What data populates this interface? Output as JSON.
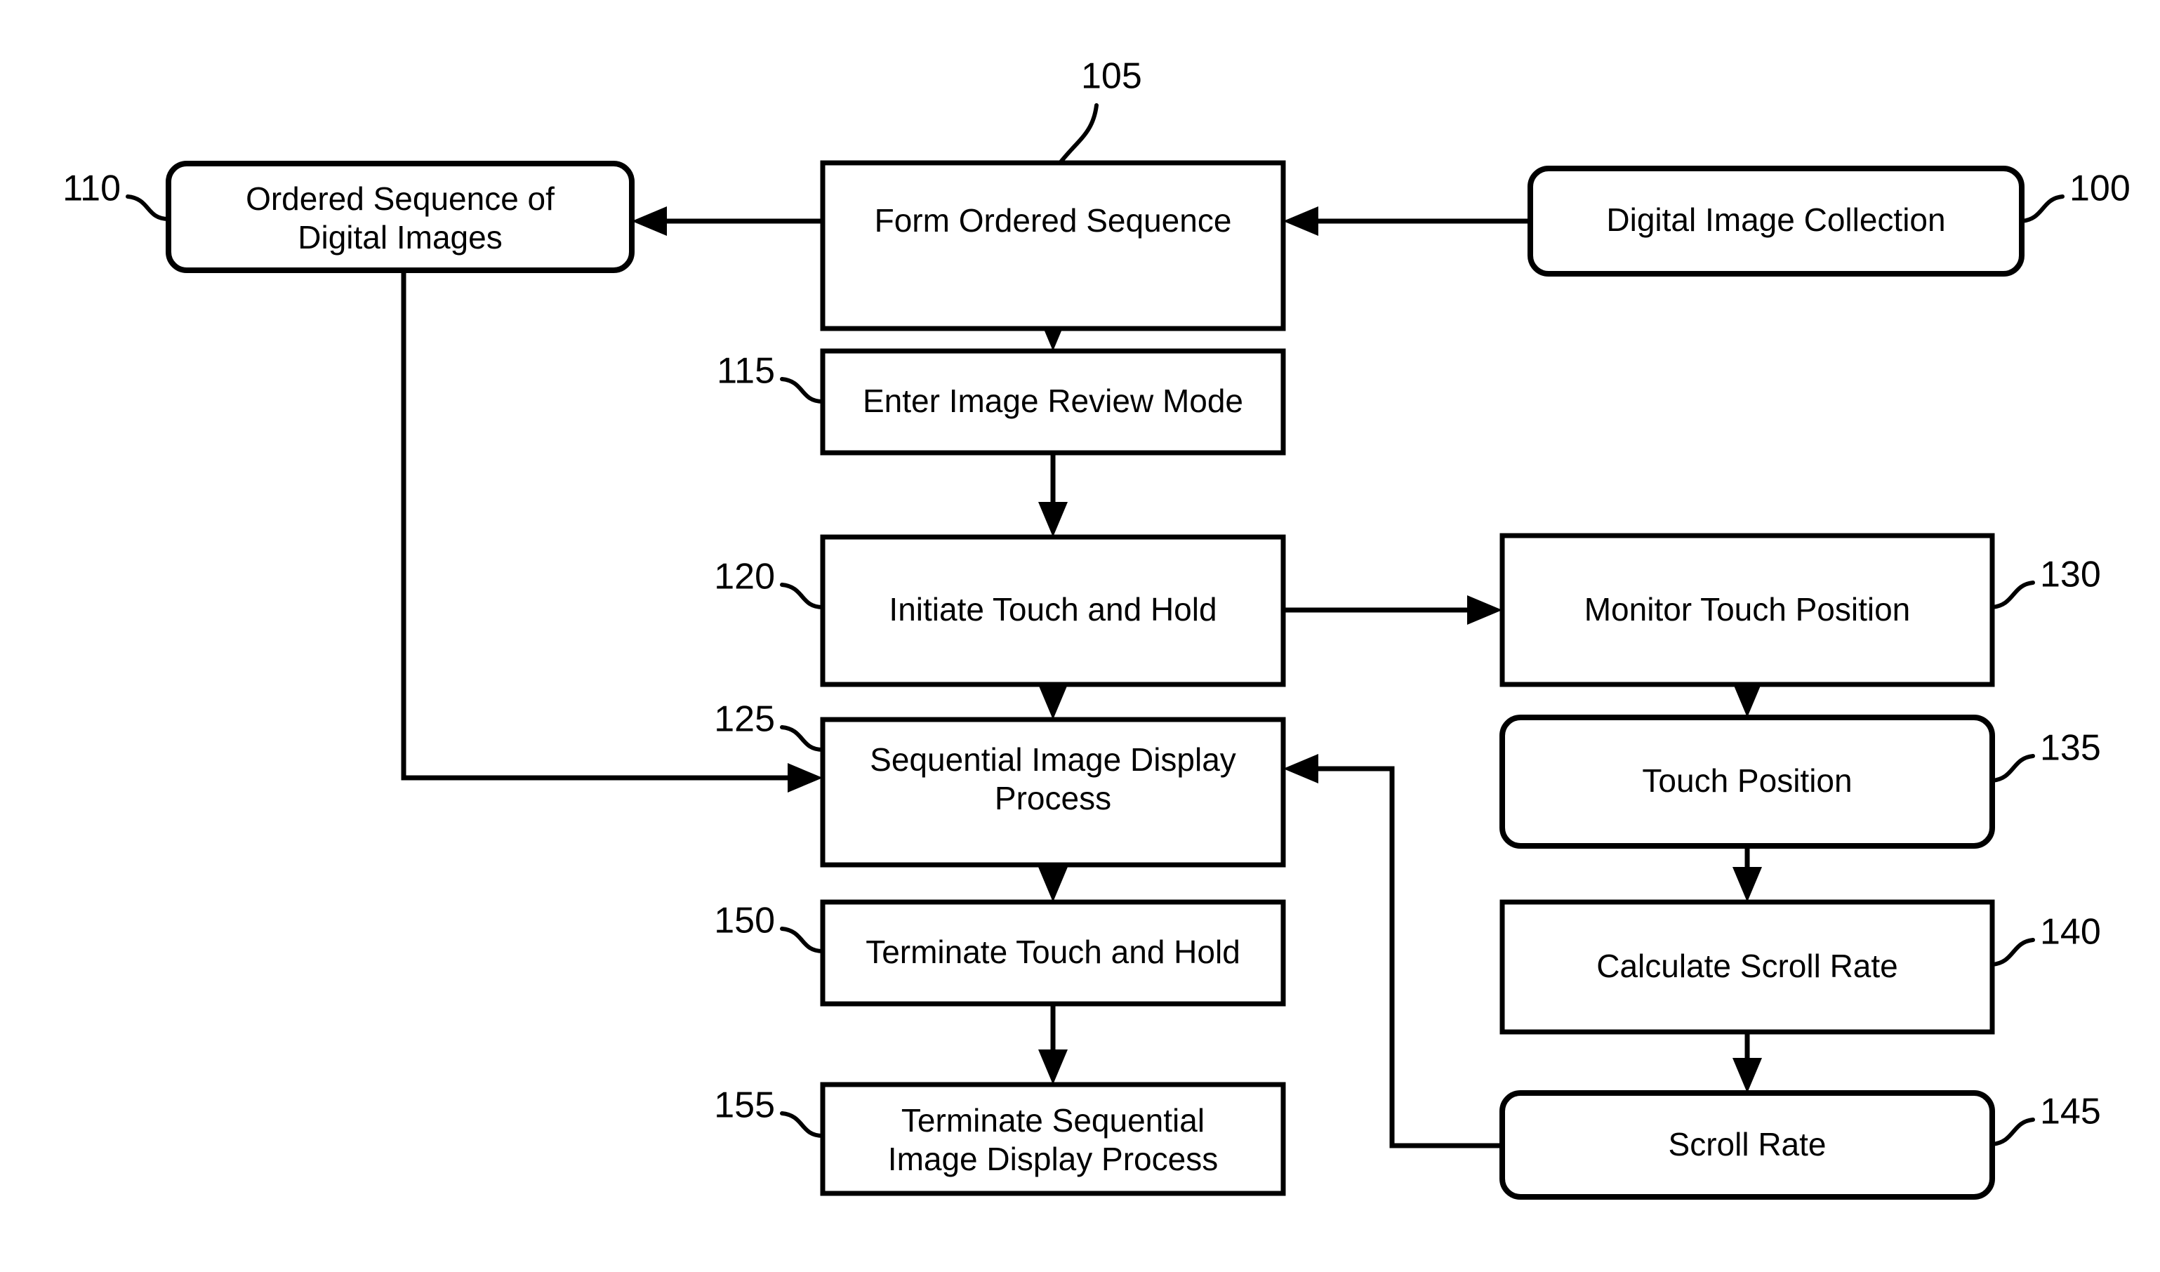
{
  "figure": {
    "type": "patent-flowchart",
    "nodes": [
      {
        "ref": "100",
        "label_line1": "Digital Image Collection",
        "label_line2": "",
        "shape": "rounded",
        "ref_side": "right"
      },
      {
        "ref": "105",
        "label_line1": "Form Ordered Sequence",
        "label_line2": "",
        "shape": "rect",
        "ref_side": "top"
      },
      {
        "ref": "110",
        "label_line1": "Ordered Sequence of",
        "label_line2": "Digital Images",
        "shape": "rounded",
        "ref_side": "left"
      },
      {
        "ref": "115",
        "label_line1": "Enter Image Review Mode",
        "label_line2": "",
        "shape": "rect",
        "ref_side": "left"
      },
      {
        "ref": "120",
        "label_line1": "Initiate Touch and Hold",
        "label_line2": "",
        "shape": "rect",
        "ref_side": "left"
      },
      {
        "ref": "125",
        "label_line1": "Sequential Image Display",
        "label_line2": "Process",
        "shape": "rect",
        "ref_side": "left"
      },
      {
        "ref": "130",
        "label_line1": "Monitor Touch Position",
        "label_line2": "",
        "shape": "rect",
        "ref_side": "right"
      },
      {
        "ref": "135",
        "label_line1": "Touch Position",
        "label_line2": "",
        "shape": "rounded",
        "ref_side": "right"
      },
      {
        "ref": "140",
        "label_line1": "Calculate Scroll Rate",
        "label_line2": "",
        "shape": "rect",
        "ref_side": "right"
      },
      {
        "ref": "145",
        "label_line1": "Scroll Rate",
        "label_line2": "",
        "shape": "rounded",
        "ref_side": "right"
      },
      {
        "ref": "150",
        "label_line1": "Terminate Touch and Hold",
        "label_line2": "",
        "shape": "rect",
        "ref_side": "left"
      },
      {
        "ref": "155",
        "label_line1": "Terminate Sequential",
        "label_line2": "Image Display Process",
        "shape": "rect",
        "ref_side": "left"
      }
    ],
    "edges": [
      {
        "from": "100",
        "to": "105",
        "direction": "left"
      },
      {
        "from": "105",
        "to": "110",
        "direction": "left"
      },
      {
        "from": "105",
        "to": "115",
        "direction": "down"
      },
      {
        "from": "115",
        "to": "120",
        "direction": "down"
      },
      {
        "from": "120",
        "to": "125",
        "direction": "down"
      },
      {
        "from": "120",
        "to": "130",
        "direction": "right"
      },
      {
        "from": "110",
        "to": "125",
        "direction": "down-right"
      },
      {
        "from": "130",
        "to": "135",
        "direction": "down"
      },
      {
        "from": "135",
        "to": "140",
        "direction": "down"
      },
      {
        "from": "140",
        "to": "145",
        "direction": "down"
      },
      {
        "from": "145",
        "to": "125",
        "direction": "left-up"
      },
      {
        "from": "125",
        "to": "150",
        "direction": "down"
      },
      {
        "from": "150",
        "to": "155",
        "direction": "down"
      }
    ],
    "colors": {
      "stroke": "#000000",
      "fill": "#ffffff",
      "background": "#ffffff"
    }
  }
}
